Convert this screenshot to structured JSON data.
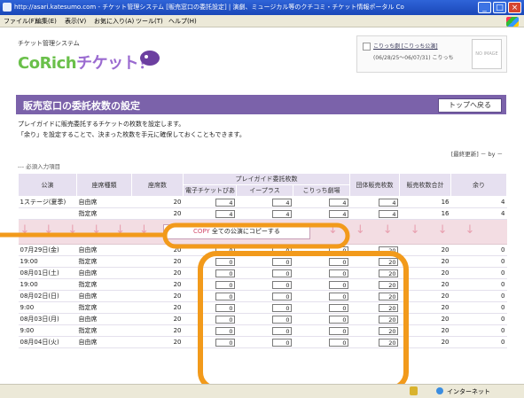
{
  "window": {
    "title": "http://asari.katesumo.com - チケット管理システム [販売窓口の委託設定] | 演劇、ミュージカル等のクチコミ・チケット情報ポータル CoRich 舞台芸術! - Micros...",
    "minimize_label": "_",
    "maximize_label": "□",
    "close_label": "×"
  },
  "menu": [
    "ファイル(F)",
    "編集(E)",
    "表示(V)",
    "お気に入り(A)",
    "ツール(T)",
    "ヘルプ(H)"
  ],
  "header": {
    "system_name": "チケット管理システム",
    "logo_co": "CoRich",
    "logo_ticket": "チケット！",
    "user_link1": "こりっち劇 [こりっち公演]",
    "user_line2": "(06/28/25～06/07/31) こりっち",
    "avatar_label": "NO IMAGE"
  },
  "page": {
    "heading": "販売窓口の委託枚数の設定",
    "top_button": "トップへ戻る",
    "desc1": "プレイガイドに販売委託するチケットの枚数を設定します。",
    "desc2": "「余り」を設定することで、決まった枚数を手元に確保しておくこともできます。",
    "sort_line": "[最終更新] － by －",
    "required_mark": "---",
    "required_text": "必須入力項目"
  },
  "table": {
    "h_performance": "公演",
    "h_seat_type": "座席種類",
    "h_seats": "座席数",
    "h_playguide": "プレイガイド委託枚数",
    "h_eticket": "電子チケットぴあ",
    "h_eplus": "イープラス",
    "h_corich": "こりっち劇場",
    "h_group": "団体販売枚数",
    "h_total": "販売枚数合計",
    "h_remain": "余り",
    "copy_prefix": "COPY",
    "copy_label": "全ての公演にコピーする",
    "arrow_glyph": "↓",
    "first": {
      "name": "1ステージ(夏季)",
      "rows": [
        {
          "seat": "自由席",
          "count": "20",
          "v1": "4",
          "v2": "4",
          "v3": "4",
          "grp": "4",
          "total": "16",
          "rem": "4"
        },
        {
          "seat": "指定席",
          "count": "20",
          "v1": "4",
          "v2": "4",
          "v3": "4",
          "grp": "4",
          "total": "16",
          "rem": "4"
        }
      ]
    },
    "perfs": [
      {
        "date": "07月29日(金)",
        "time": "19:00",
        "rows": [
          {
            "seat": "自由席",
            "count": "20",
            "v1": "0",
            "v2": "0",
            "v3": "0",
            "grp": "20",
            "total": "20",
            "rem": "0"
          },
          {
            "seat": "指定席",
            "count": "20",
            "v1": "0",
            "v2": "0",
            "v3": "0",
            "grp": "20",
            "total": "20",
            "rem": "0"
          }
        ]
      },
      {
        "date": "08月01日(土)",
        "time": "19:00",
        "rows": [
          {
            "seat": "自由席",
            "count": "20",
            "v1": "0",
            "v2": "0",
            "v3": "0",
            "grp": "20",
            "total": "20",
            "rem": "0"
          },
          {
            "seat": "指定席",
            "count": "20",
            "v1": "0",
            "v2": "0",
            "v3": "0",
            "grp": "20",
            "total": "20",
            "rem": "0"
          }
        ]
      },
      {
        "date": "08月02日(日)",
        "time": "9:00",
        "rows": [
          {
            "seat": "自由席",
            "count": "20",
            "v1": "0",
            "v2": "0",
            "v3": "0",
            "grp": "20",
            "total": "20",
            "rem": "0"
          },
          {
            "seat": "指定席",
            "count": "20",
            "v1": "0",
            "v2": "0",
            "v3": "0",
            "grp": "20",
            "total": "20",
            "rem": "0"
          }
        ]
      },
      {
        "date": "08月03日(月)",
        "time": "9:00",
        "rows": [
          {
            "seat": "自由席",
            "count": "20",
            "v1": "0",
            "v2": "0",
            "v3": "0",
            "grp": "20",
            "total": "20",
            "rem": "0"
          },
          {
            "seat": "指定席",
            "count": "20",
            "v1": "0",
            "v2": "0",
            "v3": "0",
            "grp": "20",
            "total": "20",
            "rem": "0"
          }
        ]
      },
      {
        "date": "08月04日(火)",
        "time": "",
        "rows": [
          {
            "seat": "自由席",
            "count": "20",
            "v1": "0",
            "v2": "0",
            "v3": "0",
            "grp": "20",
            "total": "20",
            "rem": "0"
          }
        ]
      }
    ]
  },
  "status": {
    "zone": "インターネット"
  },
  "colors": {
    "banner": "#7b62aa",
    "highlight": "#f29a1b",
    "copy_row": "#f3dde3"
  }
}
